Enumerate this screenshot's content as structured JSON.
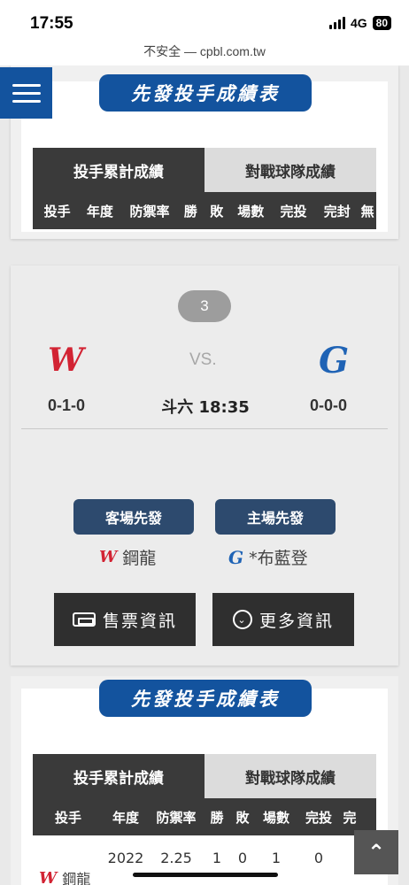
{
  "status": {
    "time": "17:55",
    "network": "4G",
    "battery": "80"
  },
  "browser": {
    "url_text": "不安全 — cpbl.com.tw"
  },
  "sections": {
    "top": {
      "ribbon": "先發投手成績表",
      "tabs": [
        "投手累計成績",
        "對戰球隊成績"
      ],
      "headers": [
        "投手",
        "年度",
        "防禦率",
        "勝",
        "敗",
        "場數",
        "完投",
        "完封",
        "無"
      ]
    },
    "bottom": {
      "ribbon": "先發投手成績表",
      "tabs": [
        "投手累計成績",
        "對戰球隊成績"
      ],
      "headers": [
        "投手",
        "年度",
        "防禦率",
        "勝",
        "敗",
        "場數",
        "完投",
        "完"
      ],
      "row": {
        "pitcher": "鋼龍",
        "year": "2022",
        "era": "2.25",
        "w": "1",
        "l": "0",
        "g": "1",
        "cg": "0"
      }
    }
  },
  "game": {
    "number": "3",
    "away_logo": "W",
    "home_logo": "G",
    "vs": "VS.",
    "away_record": "0-1-0",
    "home_record": "0-0-0",
    "venue_time": "斗六 18:35",
    "away_label": "客場先發",
    "home_label": "主場先發",
    "away_pitcher": "鋼龍",
    "home_pitcher": "*布藍登",
    "ticket_btn": "售票資訊",
    "more_btn": "更多資訊"
  },
  "colors": {
    "brand_blue": "#13539e",
    "w_red": "#d22333",
    "g_blue": "#1f63b5",
    "pill": "#2d4a6e"
  },
  "icons": [
    "menu-icon",
    "ticket-icon",
    "chevron-circle-icon",
    "arrow-up-icon"
  ]
}
